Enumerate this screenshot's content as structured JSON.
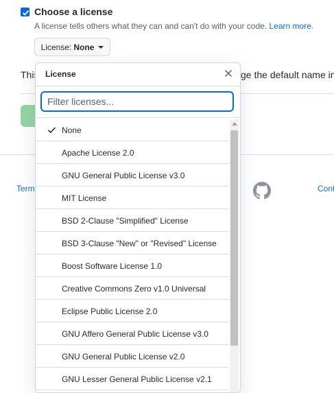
{
  "license_section": {
    "checkbox_label": "Choose a license",
    "note": "A license tells others what they can and can't do with your code.",
    "learn_more": "Learn more.",
    "button_prefix": "License:",
    "button_value": "None"
  },
  "background": {
    "left_text": "This",
    "right_text": "ge the default name in",
    "footer_terms": "Term",
    "footer_contact": "Cont"
  },
  "dropdown": {
    "title": "License",
    "filter_placeholder": "Filter licenses...",
    "items": [
      {
        "label": "None",
        "selected": true
      },
      {
        "label": "Apache License 2.0",
        "selected": false
      },
      {
        "label": "GNU General Public License v3.0",
        "selected": false
      },
      {
        "label": "MIT License",
        "selected": false
      },
      {
        "label": "BSD 2-Clause \"Simplified\" License",
        "selected": false
      },
      {
        "label": "BSD 3-Clause \"New\" or \"Revised\" License",
        "selected": false
      },
      {
        "label": "Boost Software License 1.0",
        "selected": false
      },
      {
        "label": "Creative Commons Zero v1.0 Universal",
        "selected": false
      },
      {
        "label": "Eclipse Public License 2.0",
        "selected": false
      },
      {
        "label": "GNU Affero General Public License v3.0",
        "selected": false
      },
      {
        "label": "GNU General Public License v2.0",
        "selected": false
      },
      {
        "label": "GNU Lesser General Public License v2.1",
        "selected": false
      }
    ]
  },
  "icons": {
    "checkbox": "checkmark-icon",
    "caret": "caret-down-icon",
    "close": "close-icon",
    "selected": "check-icon",
    "footer_logo": "github-logo-icon"
  },
  "colors": {
    "accent": "#0969da",
    "create_button": "#94d3a2",
    "border": "#d0d7de"
  }
}
